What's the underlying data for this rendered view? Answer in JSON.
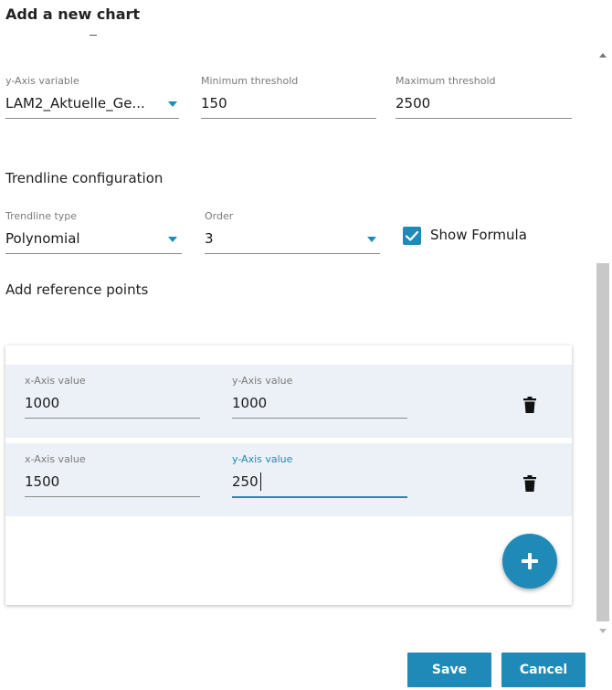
{
  "dialog": {
    "title": "Add a new chart"
  },
  "yaxis": {
    "variable_label": "y-Axis variable",
    "variable_value": "LAM2_Aktuelle_Ge...",
    "min_label": "Minimum threshold",
    "min_value": "150",
    "max_label": "Maximum threshold",
    "max_value": "2500"
  },
  "trendline": {
    "heading": "Trendline configuration",
    "type_label": "Trendline type",
    "type_value": "Polynomial",
    "order_label": "Order",
    "order_value": "3",
    "show_formula_label": "Show Formula",
    "show_formula_checked": true
  },
  "reference": {
    "heading": "Add reference points",
    "points": [
      {
        "x_label": "x-Axis value",
        "x_value": "1000",
        "y_label": "y-Axis value",
        "y_value": "1000"
      },
      {
        "x_label": "x-Axis value",
        "x_value": "1500",
        "y_label": "y-Axis value",
        "y_value": "250"
      }
    ]
  },
  "footer": {
    "save_label": "Save",
    "cancel_label": "Cancel"
  },
  "colors": {
    "accent": "#1f8ab8",
    "row_bg": "#ecf1f7"
  }
}
